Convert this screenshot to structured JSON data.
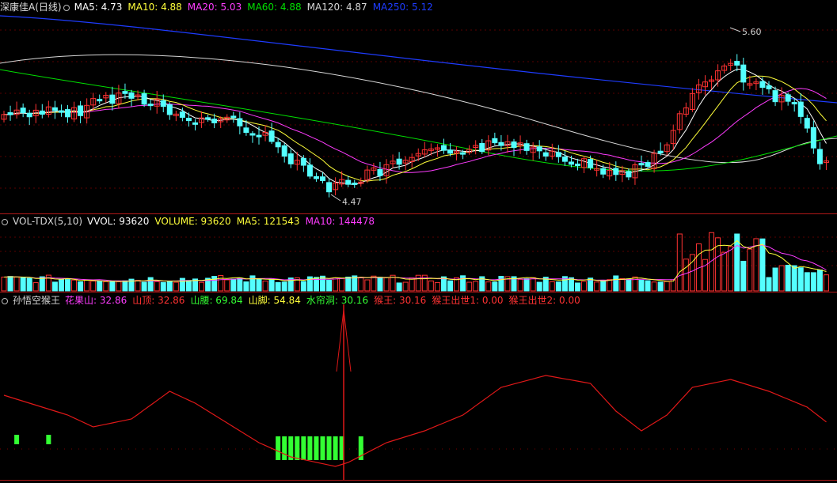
{
  "colors": {
    "background": "#000000",
    "up": "#ff3232",
    "down": "#54ffff",
    "ma5": "#ffffff",
    "ma10": "#ffff3a",
    "ma20": "#ff3cff",
    "ma60": "#00e000",
    "ma120": "#d8d8d8",
    "ma250": "#1e3cff",
    "separator": "#b01818",
    "curve": "#e01818",
    "green_bar": "#33ff33"
  },
  "price_panel": {
    "stock_name": "深康佳A",
    "period": "(日线)",
    "indicators": [
      {
        "label": "MA5:",
        "value": "4.73",
        "color": "#ffffff"
      },
      {
        "label": "MA10:",
        "value": "4.88",
        "color": "#ffff3a"
      },
      {
        "label": "MA20:",
        "value": "5.03",
        "color": "#ff3cff"
      },
      {
        "label": "MA60:",
        "value": "4.88",
        "color": "#00e000"
      },
      {
        "label": "MA120:",
        "value": "4.87",
        "color": "#d8d8d8"
      },
      {
        "label": "MA250:",
        "value": "5.12",
        "color": "#1e3cff"
      }
    ],
    "high_label": "5.60",
    "low_label": "4.47"
  },
  "volume_panel": {
    "title": "VOL-TDX(5,10)",
    "indicators": [
      {
        "label": "VVOL:",
        "value": "93620",
        "color": "#ffffff"
      },
      {
        "label": "VOLUME:",
        "value": "93620",
        "color": "#ffff3a"
      },
      {
        "label": "MA5:",
        "value": "121543",
        "color": "#ffff3a"
      },
      {
        "label": "MA10:",
        "value": "144478",
        "color": "#ff3cff"
      }
    ]
  },
  "indicator_panel": {
    "title": "孙悟空猴王",
    "indicators": [
      {
        "label": "花果山:",
        "value": "32.86",
        "color": "#ff3cff"
      },
      {
        "label": "山顶:",
        "value": "32.86",
        "color": "#ff3232"
      },
      {
        "label": "山腰:",
        "value": "69.84",
        "color": "#33ff33"
      },
      {
        "label": "山脚:",
        "value": "54.84",
        "color": "#ffff3a"
      },
      {
        "label": "水帘洞:",
        "value": "30.16",
        "color": "#33ff33"
      },
      {
        "label": "猴王:",
        "value": "30.16",
        "color": "#ff3232"
      },
      {
        "label": "猴王出世1:",
        "value": "0.00",
        "color": "#ff3232"
      },
      {
        "label": "猴王出世2:",
        "value": "0.00",
        "color": "#ff3232"
      }
    ]
  }
}
